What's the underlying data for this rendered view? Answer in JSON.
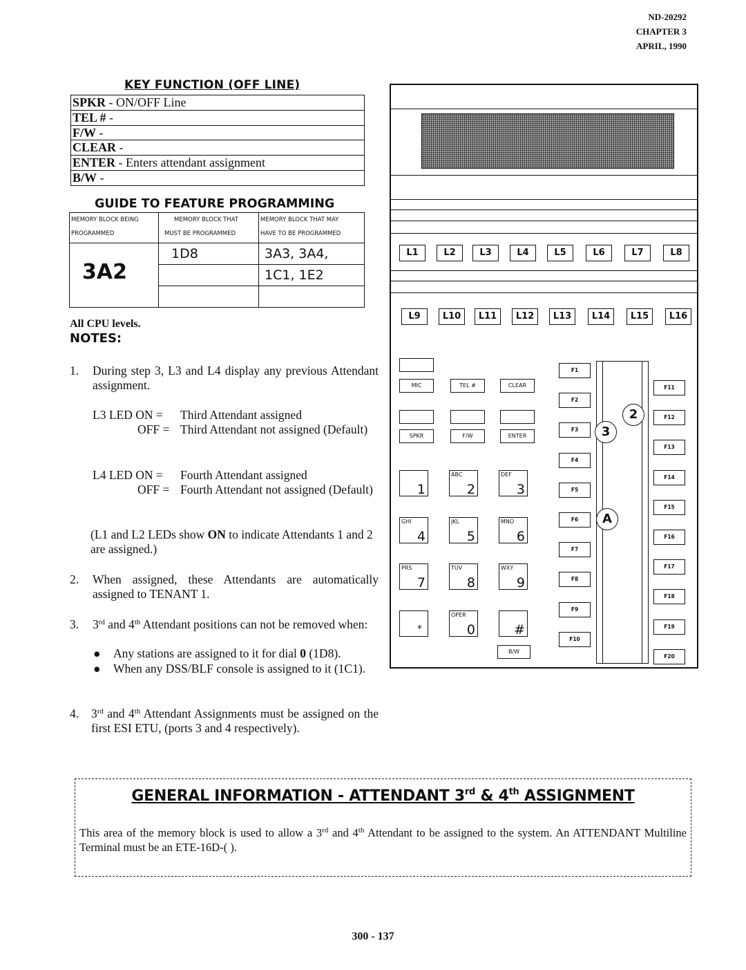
{
  "header": {
    "doc_number": "ND-20292",
    "chapter": "CHAPTER 3",
    "date": "APRIL, 1990"
  },
  "key_function": {
    "title": "KEY FUNCTION (OFF LINE)",
    "rows": [
      {
        "key": "SPKR",
        "sep": " - ",
        "desc": " ON/OFF Line"
      },
      {
        "key": "TEL #",
        "sep": " - ",
        "desc": ""
      },
      {
        "key": "F/W",
        "sep": " - ",
        "desc": ""
      },
      {
        "key": "CLEAR",
        "sep": " - ",
        "desc": ""
      },
      {
        "key": "ENTER",
        "sep": " - ",
        "desc": "  Enters attendant assignment"
      },
      {
        "key": "B/W",
        "sep": " - ",
        "desc": ""
      }
    ]
  },
  "guide": {
    "title": "GUIDE TO FEATURE PROGRAMMING",
    "headers": [
      [
        "MEMORY BLOCK BEING",
        "PROGRAMMED"
      ],
      [
        "MEMORY BLOCK THAT",
        "MUST BE PROGRAMMED"
      ],
      [
        "MEMORY BLOCK THAT MAY",
        "HAVE TO BE PROGRAMMED"
      ]
    ],
    "block_programmed": "3A2",
    "must_be_programmed": [
      "1D8",
      "",
      ""
    ],
    "may_be_programmed": [
      "3A3, 3A4,",
      "1C1, 1E2",
      ""
    ]
  },
  "cpu_levels": "All CPU levels.",
  "notes": {
    "title": "NOTES:",
    "n1": {
      "num": "1.",
      "text": "During step 3, L3 and L4 display any previous Attendant assignment.",
      "l3_on_label": "L3  LED ON =",
      "l3_on": "Third Attendant assigned",
      "l3_off_label": "OFF =",
      "l3_off": "Third Attendant not assigned (Default)",
      "l4_on_label": "L4  LED ON =",
      "l4_on": "Fourth Attendant assigned",
      "l4_off_label": "OFF =",
      "l4_off": "Fourth Attendant not assigned (Default)",
      "l1l2_pre": "(L1 and L2 LEDs show ",
      "l1l2_bold": "ON",
      "l1l2_post": " to indicate Attendants 1 and 2 are assigned.)"
    },
    "n2": {
      "num": "2.",
      "text": "When assigned, these Attendants are automatically assigned to TENANT 1."
    },
    "n3": {
      "num": "3.",
      "ord1": "3",
      "sup1": "rd",
      "mid": " and 4",
      "sup2": "th",
      "text": " Attendant positions can not be removed when:",
      "bullet1_pre": "Any stations are assigned to it  for dial ",
      "bullet1_bold": "0",
      "bullet1_post": " (1D8).",
      "bullet2": "When any DSS/BLF console is assigned to it (1C1)."
    },
    "n4": {
      "num": "4.",
      "ord1": "3",
      "sup1": "rd",
      "mid": " and 4",
      "sup2": "th",
      "text": " Attendant Assignments must be assigned on the first ESI ETU, (ports 3 and 4 respectively)."
    }
  },
  "phone": {
    "line_keys_row1": [
      "L1",
      "L2",
      "L3",
      "L4",
      "L5",
      "L6",
      "L7",
      "L8"
    ],
    "line_keys_row2": [
      "L9",
      "L10",
      "L11",
      "L12",
      "L13",
      "L14",
      "L15",
      "L16"
    ],
    "func_keys_row1": [
      "MIC",
      "TEL #",
      "CLEAR"
    ],
    "func_keys_row2": [
      "SPKR",
      "F/W",
      "ENTER"
    ],
    "keypad": [
      {
        "letters": "",
        "digit": "1"
      },
      {
        "letters": "ABC",
        "digit": "2"
      },
      {
        "letters": "DEF",
        "digit": "3"
      },
      {
        "letters": "GHI",
        "digit": "4"
      },
      {
        "letters": "JKL",
        "digit": "5"
      },
      {
        "letters": "MNO",
        "digit": "6"
      },
      {
        "letters": "PRS",
        "digit": "7"
      },
      {
        "letters": "TUV",
        "digit": "8"
      },
      {
        "letters": "WXY",
        "digit": "9"
      },
      {
        "letters": "",
        "digit": "*"
      },
      {
        "letters": "OPER",
        "digit": "0"
      },
      {
        "letters": "",
        "digit": "#"
      }
    ],
    "bw_key": "B/W",
    "f_keys_left": [
      "F1",
      "F2",
      "F3",
      "F4",
      "F5",
      "F6",
      "F7",
      "F8",
      "F9",
      "F10"
    ],
    "f_keys_right": [
      "F11",
      "F12",
      "F13",
      "F14",
      "F15",
      "F16",
      "F17",
      "F18",
      "F19",
      "F20"
    ],
    "callouts": [
      "2",
      "3",
      "A"
    ]
  },
  "general_info": {
    "title_pre": "GENERAL INFORMATION  -  ATTENDANT 3",
    "title_sup1": "rd",
    "title_mid": " & 4",
    "title_sup2": "th",
    "title_post": "  ASSIGNMENT",
    "text_pre": "This area of the memory block is used to allow a 3",
    "text_sup1": "rd",
    "text_mid": " and 4",
    "text_sup2": "th",
    "text_post": " Attendant to be assigned to the system.  An ATTENDANT Multiline Terminal must be an ETE-16D-(  )."
  },
  "page_number": "300 - 137"
}
